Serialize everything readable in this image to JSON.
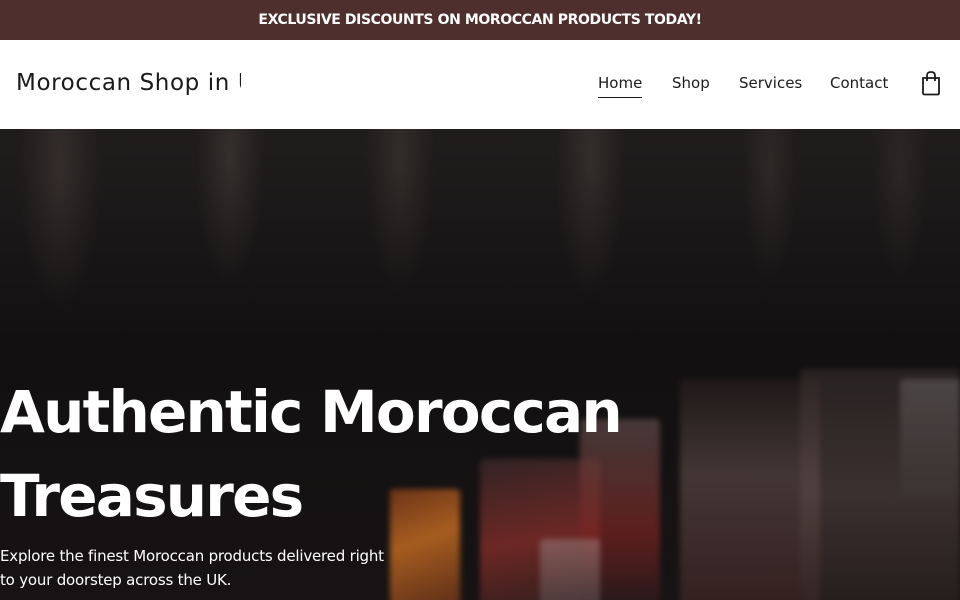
{
  "promo": {
    "text": "EXCLUSIVE DISCOUNTS ON MOROCCAN PRODUCTS TODAY!"
  },
  "header": {
    "site_title": "Moroccan Shop in UK",
    "nav": [
      {
        "label": "Home",
        "active": true
      },
      {
        "label": "Shop",
        "active": false
      },
      {
        "label": "Services",
        "active": false
      },
      {
        "label": "Contact",
        "active": false
      }
    ],
    "cart_icon": "shopping-bag-icon"
  },
  "hero": {
    "title": "Authentic Moroccan Treasures",
    "subtitle": "Explore the finest Moroccan products delivered right to your doorstep across the UK."
  },
  "colors": {
    "promo_background": "#4f2e2e",
    "header_background": "#ffffff",
    "hero_background": "#151314",
    "hero_text": "#ffffff"
  }
}
